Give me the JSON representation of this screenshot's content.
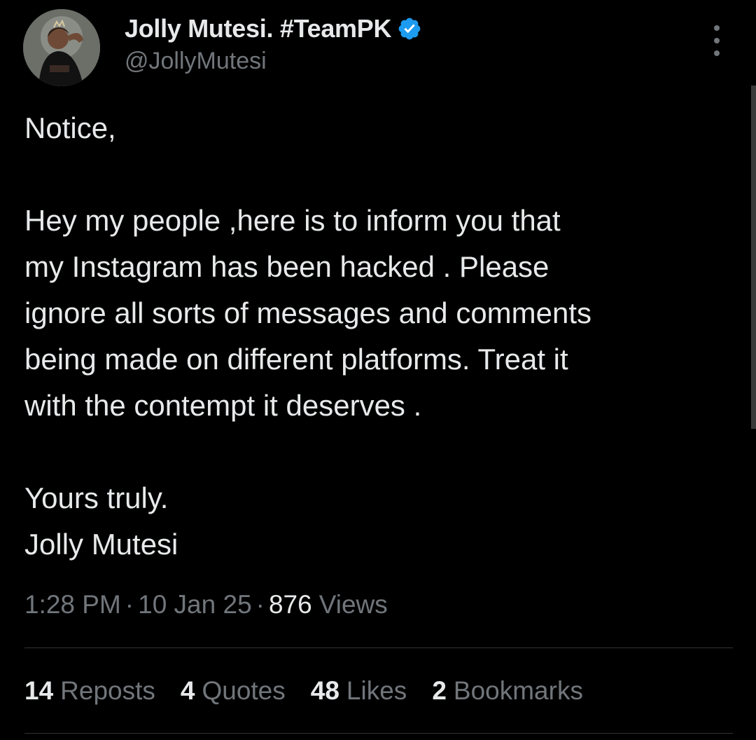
{
  "author": {
    "display_name": "Jolly Mutesi. #TeamPK",
    "handle": "@JollyMutesi",
    "verified": true,
    "verified_color": "#1d9bf0"
  },
  "tweet": {
    "paragraphs": [
      "Notice,",
      "Hey my people ,here is to inform you that\nmy Instagram has been hacked . Please\nignore all sorts of messages and comments\nbeing made on different platforms. Treat it\nwith the contempt it deserves .",
      "Yours truly.\nJolly Mutesi"
    ],
    "time": "1:28 PM",
    "date": "10 Jan 25",
    "views_count": "876",
    "views_label": "Views",
    "separator": "·"
  },
  "stats": [
    {
      "count": "14",
      "label": "Reposts"
    },
    {
      "count": "4",
      "label": "Quotes"
    },
    {
      "count": "48",
      "label": "Likes"
    },
    {
      "count": "2",
      "label": "Bookmarks"
    }
  ],
  "colors": {
    "background": "#000000",
    "primary_text": "#e7e9ea",
    "secondary_text": "#71767b",
    "divider": "#2f3336"
  },
  "icons": {
    "more": "more-vertical-icon",
    "verified": "verified-badge-icon"
  }
}
